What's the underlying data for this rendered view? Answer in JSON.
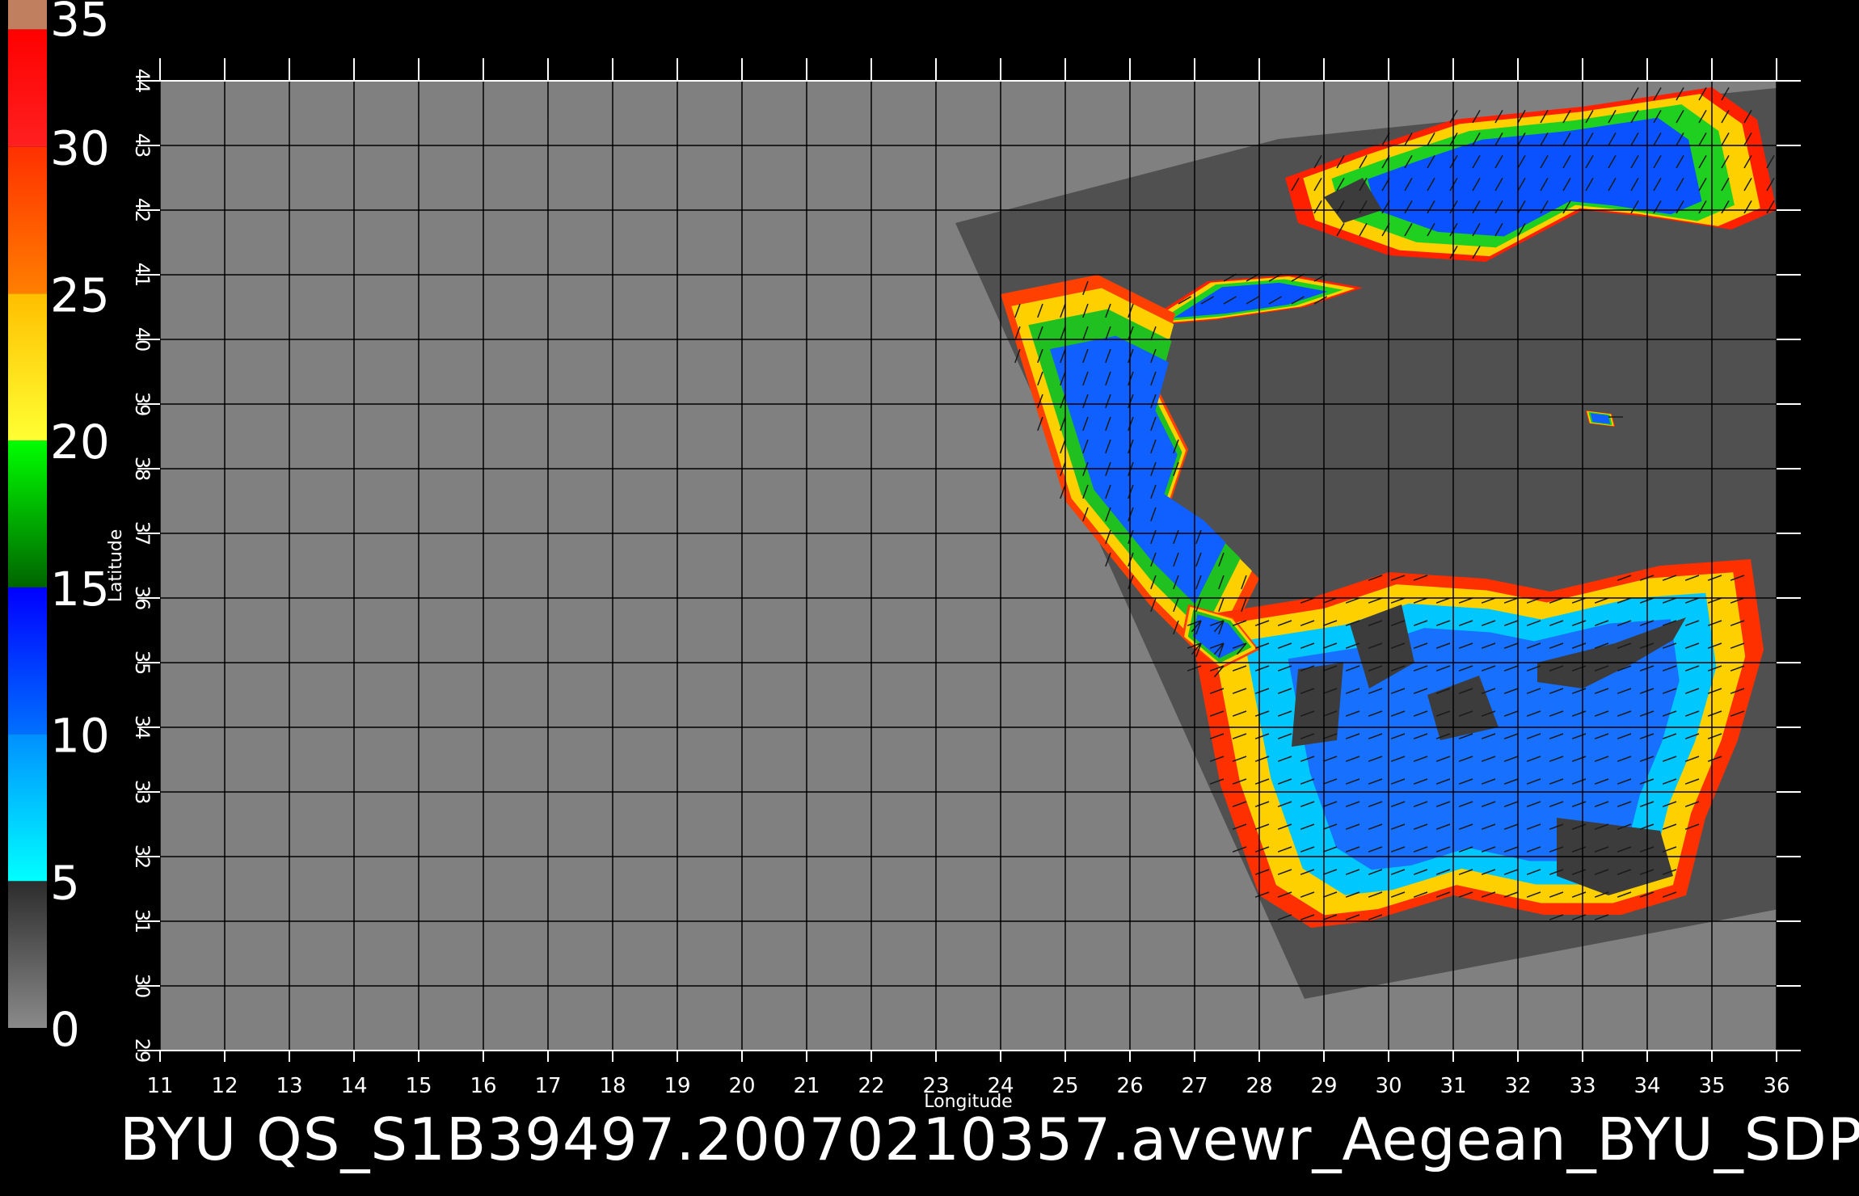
{
  "map": {
    "title": "BYU  QS_S1B39497.20070210357.avewr_Aegean_BYU_SDP",
    "xlabel": "Longitude",
    "ylabel": "Latitude",
    "lon_range": [
      11,
      36
    ],
    "lat_range": [
      29,
      44
    ],
    "lon_ticks": [
      "11",
      "12",
      "13",
      "14",
      "15",
      "16",
      "17",
      "18",
      "19",
      "20",
      "21",
      "22",
      "23",
      "24",
      "25",
      "26",
      "27",
      "28",
      "29",
      "30",
      "31",
      "32",
      "33",
      "34",
      "35",
      "36"
    ],
    "lat_ticks": [
      "29",
      "30",
      "31",
      "32",
      "33",
      "34",
      "35",
      "36",
      "37",
      "38",
      "39",
      "40",
      "41",
      "42",
      "43",
      "44"
    ],
    "grid": true,
    "background_color": "#808080",
    "swath_color": "#505050",
    "land_mask_color": "#3c3c3c",
    "colorbar": {
      "label_values": [
        "0",
        "5",
        "10",
        "15",
        "20",
        "25",
        "30",
        "35"
      ],
      "segments": [
        {
          "from": 0,
          "to": 5,
          "colors": [
            "#8a8a8a",
            "#2c2c2c"
          ]
        },
        {
          "from": 5,
          "to": 10,
          "colors": [
            "#00ffff",
            "#0090ff"
          ]
        },
        {
          "from": 10,
          "to": 15,
          "colors": [
            "#0070ff",
            "#0000ff"
          ]
        },
        {
          "from": 15,
          "to": 20,
          "colors": [
            "#006400",
            "#00ff00"
          ]
        },
        {
          "from": 20,
          "to": 25,
          "colors": [
            "#ffff33",
            "#ffbf00"
          ]
        },
        {
          "from": 25,
          "to": 30,
          "colors": [
            "#ff7f00",
            "#ff3000"
          ]
        },
        {
          "from": 30,
          "to": 34,
          "colors": [
            "#ff2020",
            "#ff0000"
          ]
        },
        {
          "from": 34,
          "to": 35,
          "colors": [
            "#c08060",
            "#c08060"
          ]
        }
      ]
    },
    "wind_regions": [
      {
        "name": "black-sea-wind-field",
        "outline": [
          [
            28.4,
            42.5
          ],
          [
            29.5,
            42.9
          ],
          [
            31,
            43.4
          ],
          [
            33,
            43.6
          ],
          [
            35,
            43.9
          ],
          [
            35.7,
            43.4
          ],
          [
            36,
            42
          ],
          [
            35.3,
            41.7
          ],
          [
            34,
            41.9
          ],
          [
            33,
            42
          ],
          [
            31.5,
            41.2
          ],
          [
            30,
            41.3
          ],
          [
            28.6,
            41.8
          ]
        ],
        "bands": [
          "#ff2000",
          "#ffd000",
          "#20d020",
          "#0a52ff"
        ],
        "wind_dir_deg": 60
      },
      {
        "name": "marmara-wind-field",
        "outline": [
          [
            26.1,
            40.2
          ],
          [
            27.2,
            40.9
          ],
          [
            28.5,
            41.0
          ],
          [
            29.6,
            40.8
          ],
          [
            28.7,
            40.5
          ],
          [
            27.3,
            40.3
          ]
        ],
        "bands": [
          "#ff2000",
          "#ffd000",
          "#20d020",
          "#0a52ff"
        ],
        "wind_dir_deg": 30
      },
      {
        "name": "aegean-wind-field",
        "outline": [
          [
            24,
            40.7
          ],
          [
            25.5,
            41.0
          ],
          [
            26.7,
            40.4
          ],
          [
            26.4,
            39.3
          ],
          [
            26.9,
            38.3
          ],
          [
            26.6,
            37.4
          ],
          [
            27.5,
            36.8
          ],
          [
            28.0,
            36.3
          ],
          [
            27.3,
            34.9
          ],
          [
            26.3,
            35.9
          ],
          [
            25.0,
            37.5
          ]
        ],
        "bands": [
          "#ff4000",
          "#ffd000",
          "#20c020",
          "#1060ff"
        ],
        "wind_dir_deg": 250
      },
      {
        "name": "levantine-wind-field",
        "outline": [
          [
            26.9,
            35.7
          ],
          [
            28.8,
            36.0
          ],
          [
            30.0,
            36.4
          ],
          [
            31.5,
            36.3
          ],
          [
            32.5,
            36.1
          ],
          [
            34.2,
            36.5
          ],
          [
            35.6,
            36.6
          ],
          [
            35.8,
            35.2
          ],
          [
            35.4,
            33.8
          ],
          [
            34.9,
            32.6
          ],
          [
            34.6,
            31.4
          ],
          [
            33.6,
            31.1
          ],
          [
            32.4,
            31.1
          ],
          [
            31.0,
            31.4
          ],
          [
            29.7,
            31.0
          ],
          [
            28.8,
            30.9
          ],
          [
            28.0,
            31.4
          ],
          [
            27.4,
            33.1
          ]
        ],
        "bands": [
          "#ff3000",
          "#ffd000",
          "#00c8ff",
          "#1870ff"
        ],
        "wind_dir_deg": 200
      },
      {
        "name": "crete-coast-wind-field",
        "outline": [
          [
            26.9,
            35.9
          ],
          [
            27.6,
            35.7
          ],
          [
            28.0,
            35.2
          ],
          [
            27.4,
            34.9
          ],
          [
            26.8,
            35.4
          ]
        ],
        "bands": [
          "#ff4000",
          "#ffd000",
          "#20c020",
          "#1060ff"
        ],
        "wind_dir_deg": 230
      },
      {
        "name": "lake-wind-field",
        "outline": [
          [
            33.05,
            38.9
          ],
          [
            33.45,
            38.85
          ],
          [
            33.5,
            38.65
          ],
          [
            33.1,
            38.7
          ]
        ],
        "bands": [
          "#ff3000",
          "#ffd000",
          "#20d020",
          "#1060ff"
        ],
        "wind_dir_deg": 0
      }
    ],
    "land_masks": [
      {
        "name": "cyprus-land",
        "outline": [
          [
            32.3,
            35.0
          ],
          [
            33.5,
            35.3
          ],
          [
            34.6,
            35.7
          ],
          [
            34.4,
            35.35
          ],
          [
            33.8,
            35.0
          ],
          [
            33.0,
            34.6
          ],
          [
            32.3,
            34.7
          ]
        ]
      },
      {
        "name": "rain-flag-patch-1",
        "outline": [
          [
            29.4,
            35.6
          ],
          [
            30.2,
            35.9
          ],
          [
            30.4,
            35.0
          ],
          [
            29.7,
            34.6
          ]
        ]
      },
      {
        "name": "rain-flag-patch-2",
        "outline": [
          [
            28.6,
            34.9
          ],
          [
            29.3,
            35.0
          ],
          [
            29.2,
            33.8
          ],
          [
            28.5,
            33.7
          ]
        ]
      },
      {
        "name": "rain-flag-patch-3",
        "outline": [
          [
            30.6,
            34.5
          ],
          [
            31.4,
            34.8
          ],
          [
            31.7,
            34.0
          ],
          [
            30.8,
            33.8
          ]
        ]
      },
      {
        "name": "rain-flag-patch-4",
        "outline": [
          [
            32.6,
            32.6
          ],
          [
            34.2,
            32.4
          ],
          [
            34.4,
            31.7
          ],
          [
            33.4,
            31.4
          ],
          [
            32.6,
            31.7
          ]
        ]
      },
      {
        "name": "rain-flag-patch-5",
        "outline": [
          [
            29.0,
            42.2
          ],
          [
            29.6,
            42.5
          ],
          [
            29.9,
            42.0
          ],
          [
            29.3,
            41.8
          ]
        ]
      }
    ]
  }
}
